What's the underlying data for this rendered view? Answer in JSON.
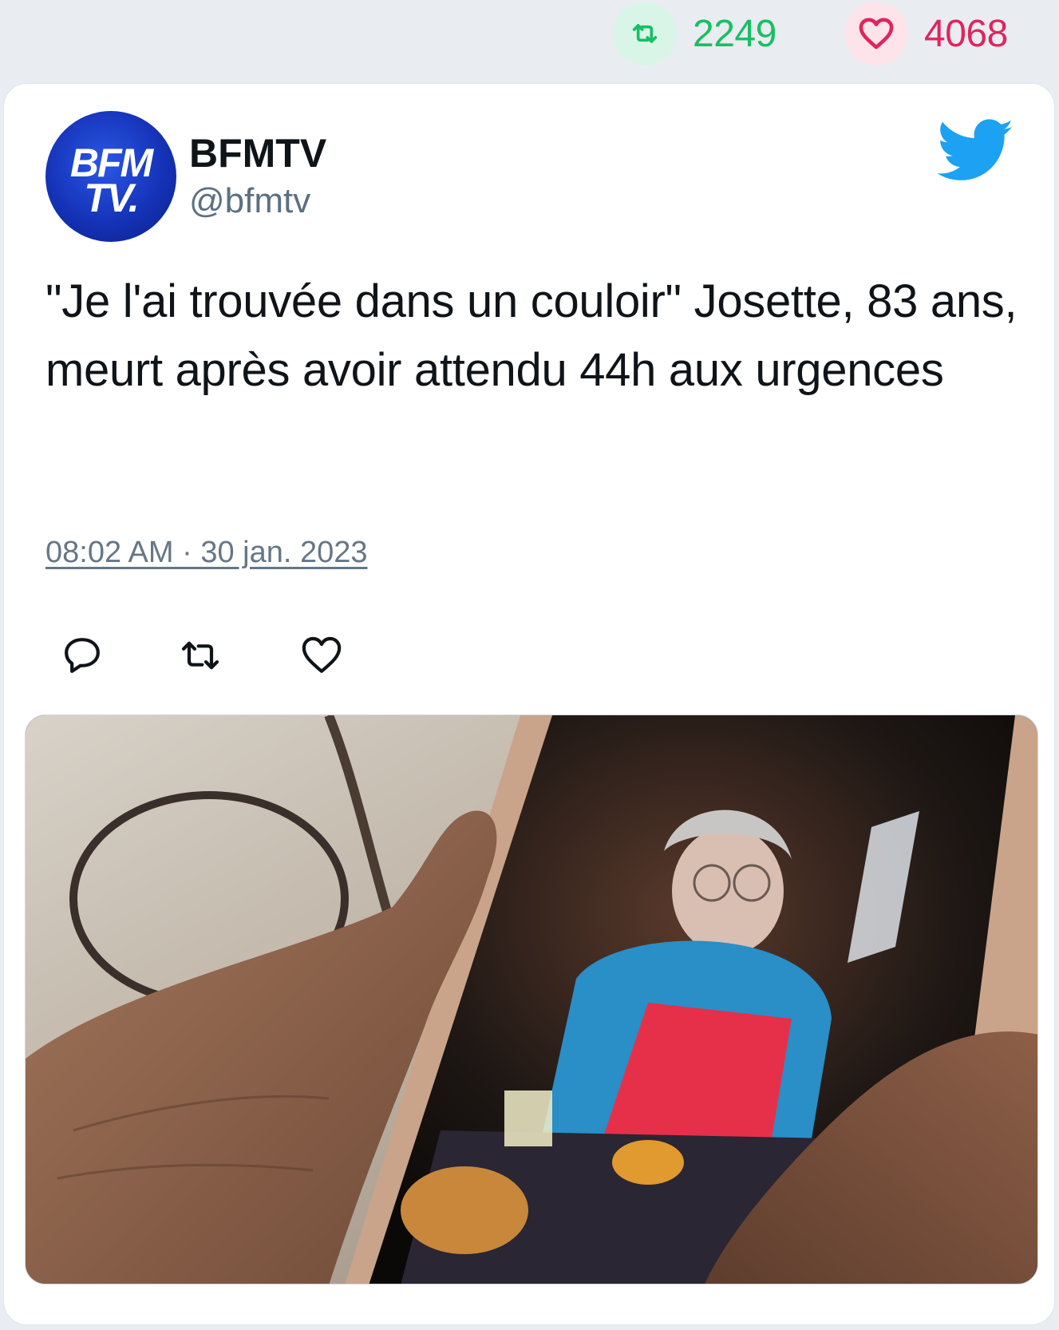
{
  "stats": {
    "retweets": "2249",
    "likes": "4068"
  },
  "tweet": {
    "author": {
      "name": "BFMTV",
      "handle": "@bfmtv",
      "avatar_logo_line1": "BFM",
      "avatar_logo_line2": "TV."
    },
    "text": "\"Je l'ai trouvée dans un couloir\" Josette, 83 ans, meurt après avoir attendu 44h aux urgences",
    "timestamp": "08:02 AM · 30 jan. 2023"
  },
  "icons": {
    "retweet": "retweet-icon",
    "like": "heart-icon",
    "reply": "reply-icon",
    "brand": "twitter-bird-icon"
  },
  "colors": {
    "retweet_green": "#17bf63",
    "like_pink": "#e0245e",
    "twitter_blue": "#1da1f2",
    "handle_gray": "#5b7083"
  }
}
